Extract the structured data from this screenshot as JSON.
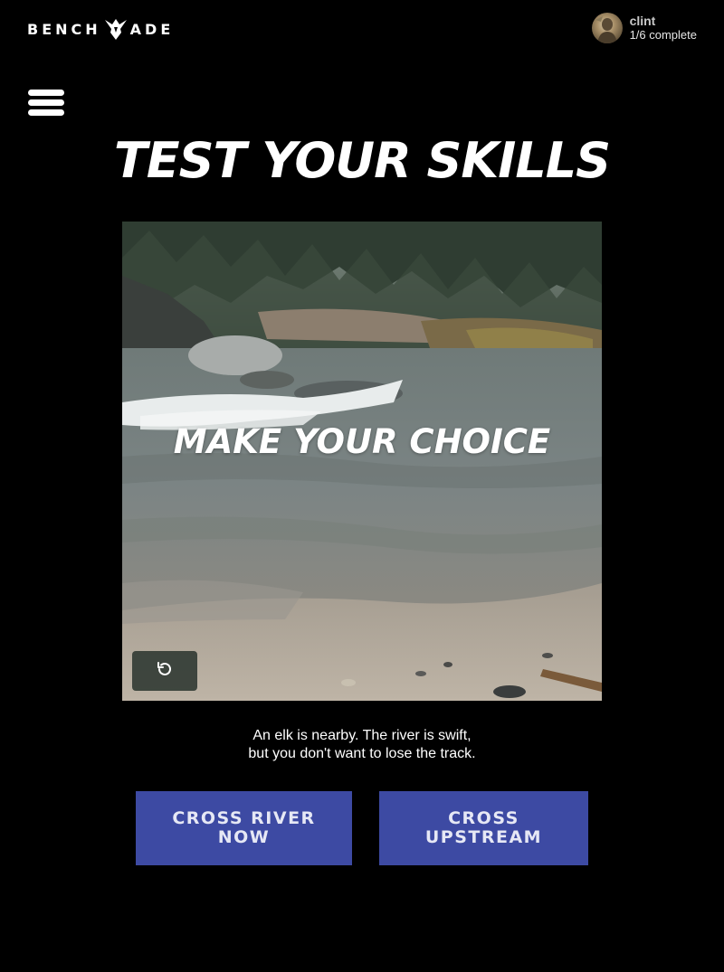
{
  "header": {
    "logo_left": "BENCH",
    "logo_right": "ADE",
    "user": {
      "name": "clint",
      "progress": "1/6 complete"
    }
  },
  "title": "TEST YOUR SKILLS",
  "video": {
    "overlay_text": "MAKE YOUR CHOICE",
    "replay_icon": "replay-icon"
  },
  "description": {
    "line1": "An elk is nearby. The river is swift,",
    "line2": "but you don't want to lose the track."
  },
  "choices": [
    {
      "line1": "CROSS RIVER",
      "line2": "NOW"
    },
    {
      "line1": "CROSS",
      "line2": "UPSTREAM"
    }
  ],
  "colors": {
    "background": "#000000",
    "button": "#3d4aa3",
    "button_text": "#e6e8f5"
  }
}
